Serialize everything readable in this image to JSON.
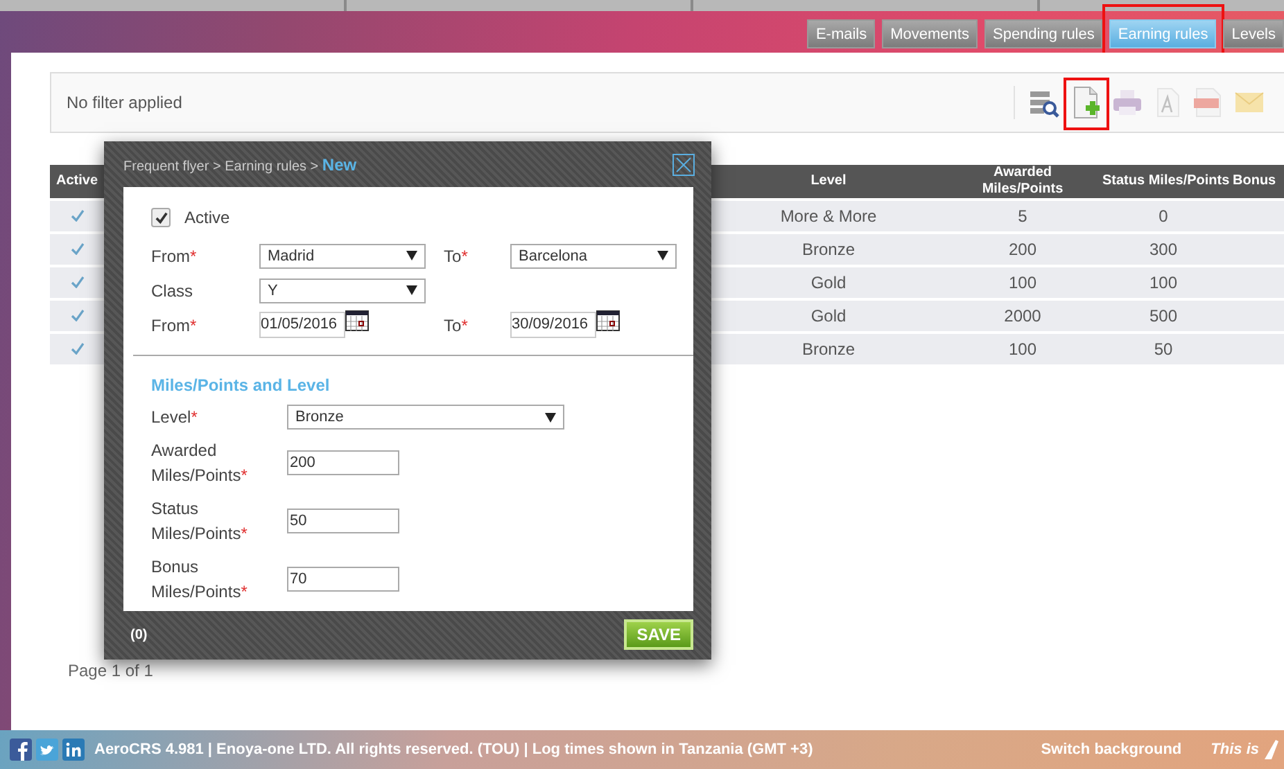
{
  "tabs": [
    {
      "label": "E-mails",
      "selected": false,
      "highlighted": false
    },
    {
      "label": "Movements",
      "selected": false,
      "highlighted": false
    },
    {
      "label": "Spending rules",
      "selected": false,
      "highlighted": false
    },
    {
      "label": "Earning rules",
      "selected": true,
      "highlighted": true
    },
    {
      "label": "Levels",
      "selected": false,
      "highlighted": false
    }
  ],
  "toolbar": {
    "filter_text": "No filter applied",
    "tools": [
      {
        "kind": "filter",
        "highlighted": false,
        "disabled": false
      },
      {
        "kind": "add",
        "highlighted": true,
        "disabled": false
      },
      {
        "kind": "print",
        "highlighted": false,
        "disabled": true
      },
      {
        "kind": "font",
        "highlighted": false,
        "disabled": true
      },
      {
        "kind": "pdf",
        "highlighted": false,
        "disabled": true
      },
      {
        "kind": "mail",
        "highlighted": false,
        "disabled": true
      }
    ]
  },
  "table": {
    "columns": [
      "Active",
      "Level",
      "Awarded Miles/Points",
      "Status Miles/Points",
      "Bonus"
    ],
    "rows": [
      {
        "active": true,
        "level": "More & More",
        "awarded": "5",
        "status": "0"
      },
      {
        "active": true,
        "level": "Bronze",
        "awarded": "200",
        "status": "300"
      },
      {
        "active": true,
        "level": "Gold",
        "awarded": "100",
        "status": "100"
      },
      {
        "active": true,
        "level": "Gold",
        "awarded": "2000",
        "status": "500"
      },
      {
        "active": true,
        "level": "Bronze",
        "awarded": "100",
        "status": "50"
      }
    ]
  },
  "pager": "Page 1 of 1",
  "dialog": {
    "breadcrumb": "Frequent flyer > Earning rules > ",
    "current": "New",
    "active": {
      "label": "Active",
      "checked": true
    },
    "route": {
      "from_label": "From",
      "from_value": "Madrid",
      "to_label": "To",
      "to_value": "Barcelona",
      "required_mark": "*"
    },
    "class": {
      "label": "Class",
      "value": "Y"
    },
    "dates": {
      "from_label": "From",
      "from_value": "01/05/2016",
      "to_label": "To",
      "to_value": "30/09/2016",
      "required_mark": "*"
    },
    "section_title": "Miles/Points and Level",
    "level": {
      "label": "Level",
      "value": "Bronze",
      "required_mark": "*"
    },
    "amounts": [
      {
        "label": "Awarded Miles/Points",
        "value": "200",
        "required_mark": "*"
      },
      {
        "label": "Status Miles/Points",
        "value": "50",
        "required_mark": "*"
      },
      {
        "label": "Bonus Miles/Points",
        "value": "70",
        "required_mark": "*"
      }
    ],
    "count": "(0)",
    "save": "SAVE"
  },
  "footer": {
    "text": "AeroCRS 4.981  | Enoya-one LTD. All rights reserved. (TOU)  | Log times shown in Tanzania (GMT +3)",
    "switch": "Switch background",
    "tagline": "This is"
  }
}
